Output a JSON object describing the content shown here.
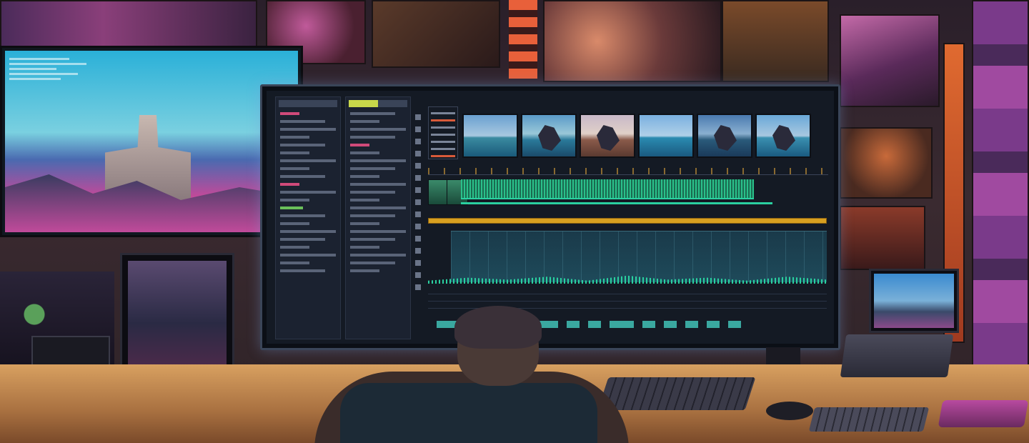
{
  "scene": {
    "description_free": true,
    "colors": {
      "accent_teal": "#2ad0a0",
      "timeline_gold": "#d8a020",
      "monitor_glow": "#78a0dc"
    },
    "main_monitor": {
      "app": "video-editor",
      "thumbnail_count": 6
    }
  }
}
